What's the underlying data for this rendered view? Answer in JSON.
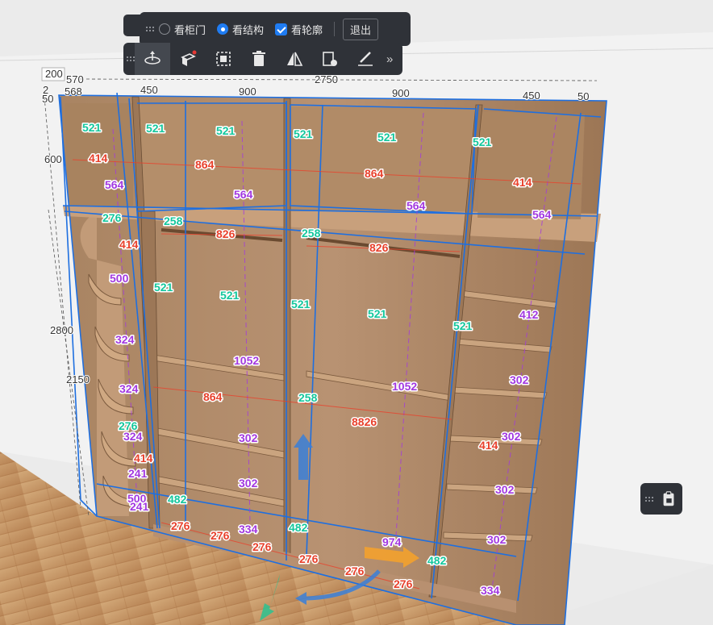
{
  "toolbar": {
    "view_options": [
      {
        "label": "看柜门",
        "state": "unselected"
      },
      {
        "label": "看结构",
        "state": "selected"
      },
      {
        "label": "看轮廓",
        "state": "checked"
      }
    ],
    "exit_label": "退出",
    "tools": [
      {
        "name": "rotate-view-icon",
        "active": true
      },
      {
        "name": "cabinet-edit-icon",
        "active": false
      },
      {
        "name": "select-box-icon",
        "active": false
      },
      {
        "name": "trash-icon",
        "active": false
      },
      {
        "name": "mirror-icon",
        "active": false
      },
      {
        "name": "cabinet-settings-icon",
        "active": false
      },
      {
        "name": "measure-icon",
        "active": false
      }
    ],
    "more_label": "»",
    "side_button_icon": "clipboard-icon"
  },
  "overall_dimensions": {
    "d200": "200",
    "d570": "570",
    "d568": "568",
    "d450a": "450",
    "d900a": "900",
    "d2750": "2750",
    "d900b": "900",
    "d450b": "450",
    "d50a": "50",
    "d2": "2",
    "d50b": "50",
    "d600": "600",
    "d2800": "2800",
    "d2150": "2150"
  },
  "red_labels": [
    "414",
    "864",
    "864",
    "414",
    "414",
    "826",
    "826",
    "864",
    "8826",
    "414",
    "414",
    "276",
    "276",
    "276",
    "276",
    "276",
    "276"
  ],
  "green_labels": [
    "521",
    "521",
    "521",
    "521",
    "521",
    "521",
    "276",
    "258",
    "258",
    "521",
    "521",
    "521",
    "521",
    "521",
    "258",
    "276",
    "482",
    "482",
    "482"
  ],
  "purple_labels": [
    "564",
    "564",
    "564",
    "564",
    "500",
    "324",
    "324",
    "324",
    "241",
    "500",
    "241",
    "1052",
    "1052",
    "302",
    "302",
    "334",
    "974",
    "412",
    "302",
    "302",
    "302",
    "302",
    "334"
  ]
}
